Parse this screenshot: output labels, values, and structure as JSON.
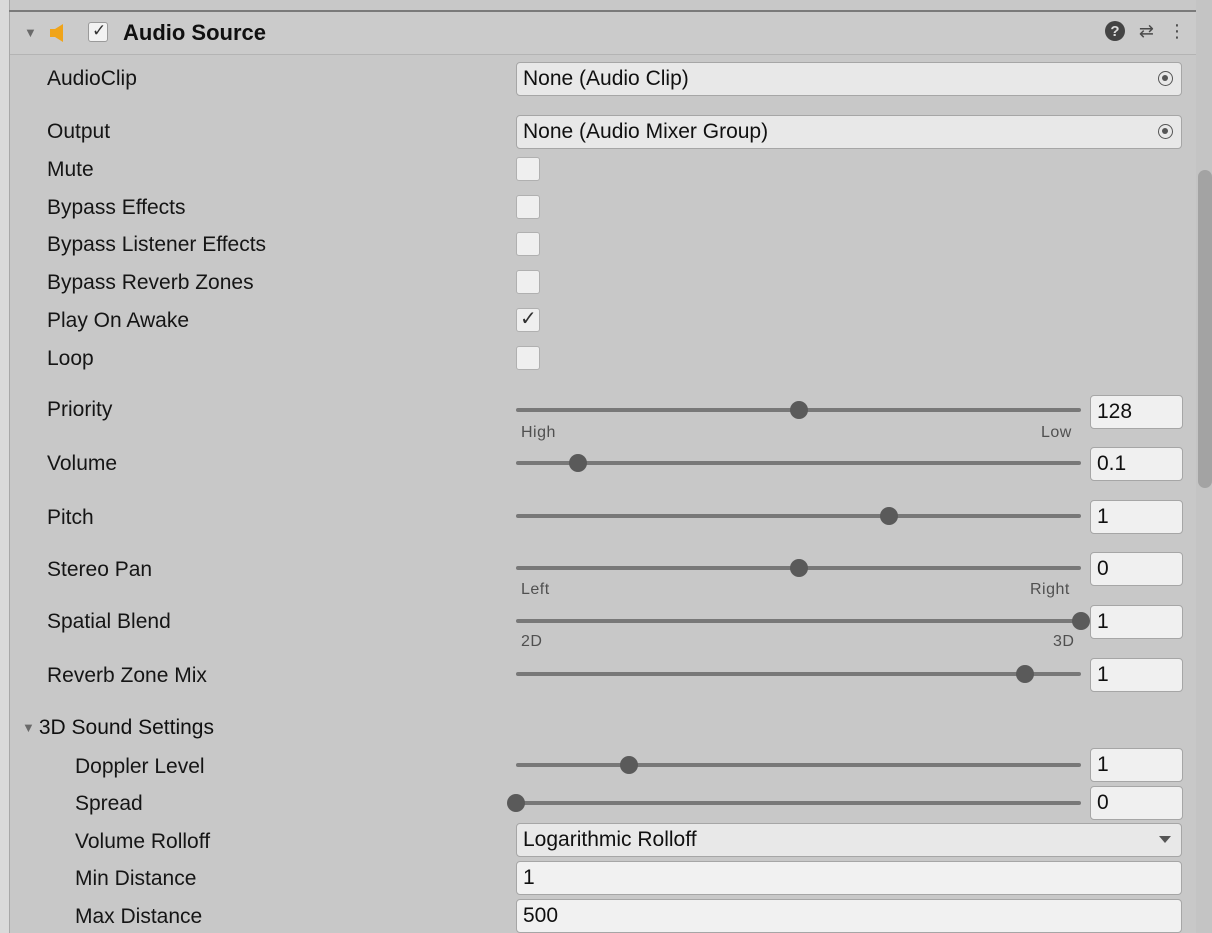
{
  "component": {
    "title": "Audio Source",
    "enabled": true
  },
  "properties": {
    "audio_clip": {
      "label": "AudioClip",
      "value": "None (Audio Clip)"
    },
    "output": {
      "label": "Output",
      "value": "None (Audio Mixer Group)"
    },
    "mute": {
      "label": "Mute",
      "checked": false
    },
    "bypass_effects": {
      "label": "Bypass Effects",
      "checked": false
    },
    "bypass_listener_effects": {
      "label": "Bypass Listener Effects",
      "checked": false
    },
    "bypass_reverb_zones": {
      "label": "Bypass Reverb Zones",
      "checked": false
    },
    "play_on_awake": {
      "label": "Play On Awake",
      "checked": true
    },
    "loop": {
      "label": "Loop",
      "checked": false
    },
    "priority": {
      "label": "Priority",
      "value": "128",
      "min_label": "High",
      "max_label": "Low",
      "level": 0.5
    },
    "volume": {
      "label": "Volume",
      "value": "0.1",
      "level": 0.11
    },
    "pitch": {
      "label": "Pitch",
      "value": "1",
      "level": 0.66
    },
    "stereo_pan": {
      "label": "Stereo Pan",
      "value": "0",
      "min_label": "Left",
      "max_label": "Right",
      "level": 0.5
    },
    "spatial_blend": {
      "label": "Spatial Blend",
      "value": "1",
      "min_label": "2D",
      "max_label": "3D",
      "level": 1.0
    },
    "reverb_zone_mix": {
      "label": "Reverb Zone Mix",
      "value": "1",
      "level": 0.9
    }
  },
  "sound3d": {
    "label": "3D Sound Settings",
    "doppler_level": {
      "label": "Doppler Level",
      "value": "1",
      "level": 0.2
    },
    "spread": {
      "label": "Spread",
      "value": "0",
      "level": 0.0
    },
    "volume_rolloff": {
      "label": "Volume Rolloff",
      "value": "Logarithmic Rolloff"
    },
    "min_distance": {
      "label": "Min Distance",
      "value": "1"
    },
    "max_distance": {
      "label": "Max Distance",
      "value": "500"
    }
  },
  "icons": [
    "speaker-icon",
    "help-icon",
    "presets-icon",
    "more-options-icon"
  ],
  "colors": {
    "speaker": "#f0a419",
    "panel": "#c8c8c8"
  }
}
